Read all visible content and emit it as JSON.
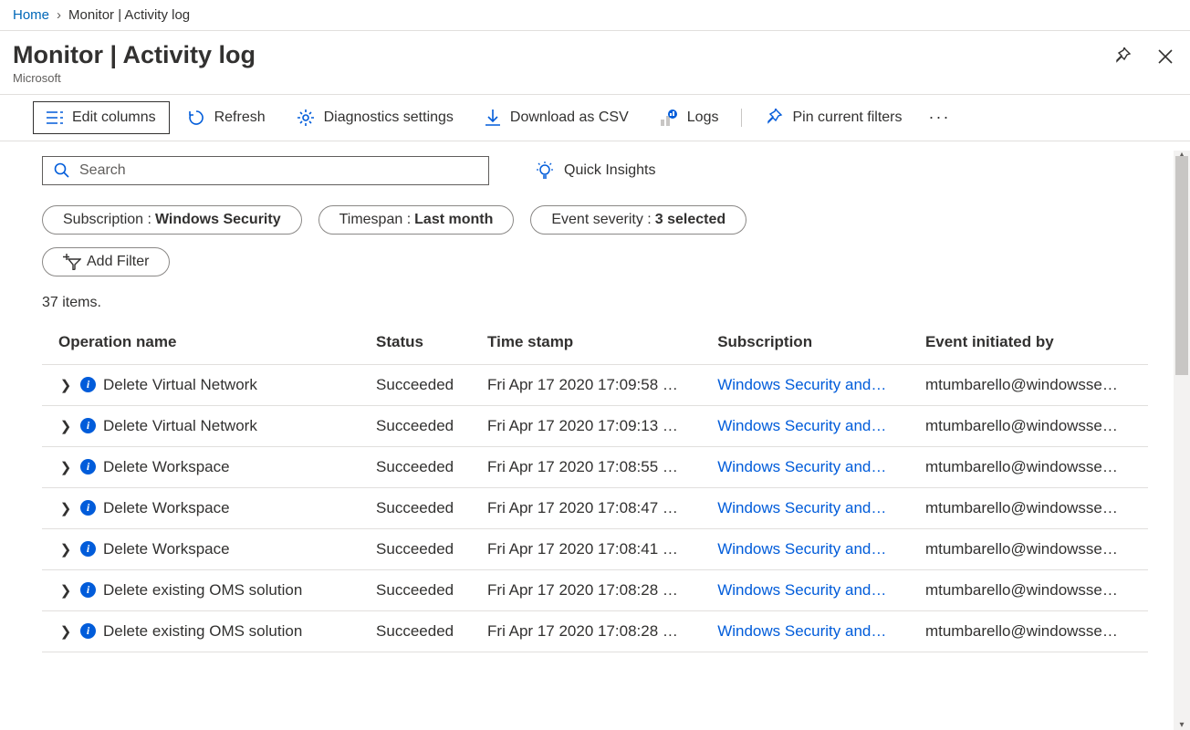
{
  "breadcrumb": {
    "home": "Home",
    "current": "Monitor | Activity log"
  },
  "header": {
    "title": "Monitor | Activity log",
    "subtitle": "Microsoft"
  },
  "toolbar": {
    "edit_columns": "Edit columns",
    "refresh": "Refresh",
    "diagnostics": "Diagnostics settings",
    "download_csv": "Download as CSV",
    "logs": "Logs",
    "pin_filters": "Pin current filters"
  },
  "search": {
    "placeholder": "Search",
    "quick_insights": "Quick Insights"
  },
  "filters": {
    "pills": [
      {
        "label": "Subscription : ",
        "value": "Windows Security"
      },
      {
        "label": "Timespan : ",
        "value": "Last month"
      },
      {
        "label": "Event severity : ",
        "value": "3 selected"
      }
    ],
    "add_filter": "Add Filter"
  },
  "count_text": "37 items.",
  "columns": {
    "operation": "Operation name",
    "status": "Status",
    "timestamp": "Time stamp",
    "subscription": "Subscription",
    "initiated": "Event initiated by"
  },
  "rows": [
    {
      "op": "Delete Virtual Network",
      "status": "Succeeded",
      "time": "Fri Apr 17 2020 17:09:58 …",
      "sub": "Windows Security and…",
      "init": "mtumbarello@windowsse…"
    },
    {
      "op": "Delete Virtual Network",
      "status": "Succeeded",
      "time": "Fri Apr 17 2020 17:09:13 …",
      "sub": "Windows Security and…",
      "init": "mtumbarello@windowsse…"
    },
    {
      "op": "Delete Workspace",
      "status": "Succeeded",
      "time": "Fri Apr 17 2020 17:08:55 …",
      "sub": "Windows Security and…",
      "init": "mtumbarello@windowsse…"
    },
    {
      "op": "Delete Workspace",
      "status": "Succeeded",
      "time": "Fri Apr 17 2020 17:08:47 …",
      "sub": "Windows Security and…",
      "init": "mtumbarello@windowsse…"
    },
    {
      "op": "Delete Workspace",
      "status": "Succeeded",
      "time": "Fri Apr 17 2020 17:08:41 …",
      "sub": "Windows Security and…",
      "init": "mtumbarello@windowsse…"
    },
    {
      "op": "Delete existing OMS solution",
      "status": "Succeeded",
      "time": "Fri Apr 17 2020 17:08:28 …",
      "sub": "Windows Security and…",
      "init": "mtumbarello@windowsse…"
    },
    {
      "op": "Delete existing OMS solution",
      "status": "Succeeded",
      "time": "Fri Apr 17 2020 17:08:28 …",
      "sub": "Windows Security and…",
      "init": "mtumbarello@windowsse…"
    }
  ]
}
